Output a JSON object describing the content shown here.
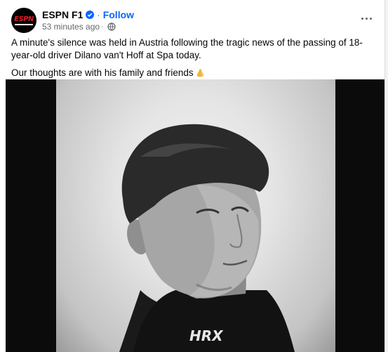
{
  "post": {
    "page_name": "ESPN F1",
    "follow_label": "Follow",
    "separator": "·",
    "timestamp": "53 minutes ago",
    "avatar_text": "ESPN",
    "paragraph1": "A minute's silence was held in Austria following the tragic news of the passing of 18-year-old driver Dilano van't Hoff at Spa today.",
    "paragraph2": "Our thoughts are with his family and friends",
    "photo_brand": "HRX"
  },
  "icons": {
    "verified": "verified-badge-icon",
    "privacy": "globe-icon",
    "more": "more-options-icon",
    "emoji": "folded-hands-emoji-icon"
  },
  "colors": {
    "accent": "#0866ff",
    "secondary_text": "#65676b",
    "primary_text": "#050505"
  }
}
